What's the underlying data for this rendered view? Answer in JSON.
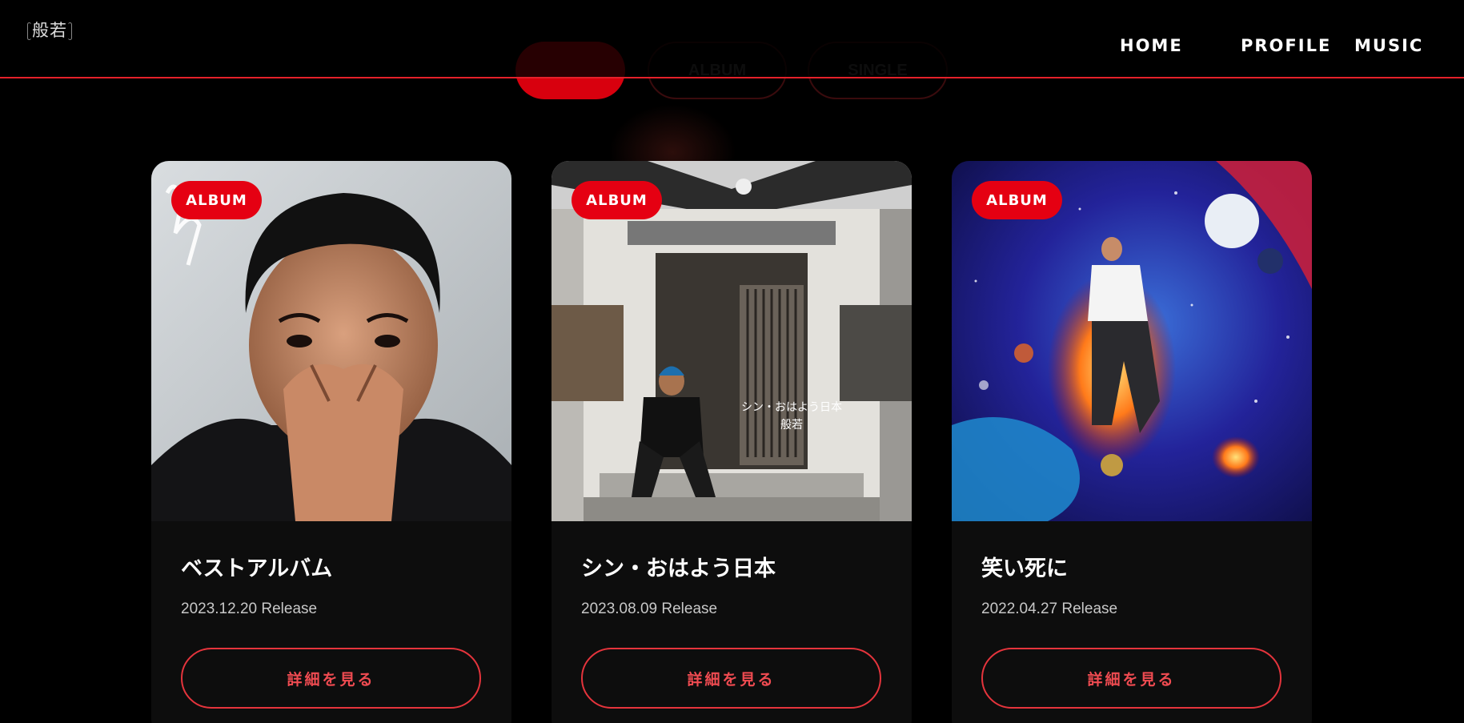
{
  "header": {
    "logo_text": "般若",
    "nav": {
      "home": "HOME",
      "profile": "PROFILE",
      "music": "MUSIC"
    }
  },
  "filters": {
    "album": "ALBUM",
    "single": "SINGLE"
  },
  "colors": {
    "accent": "#e50012",
    "outline": "#e5343c",
    "background": "#000000",
    "card": "#0d0d0d"
  },
  "cards": [
    {
      "badge": "ALBUM",
      "title": "ベストアルバム",
      "date": "2023.12.20 Release",
      "button": "詳細を見る"
    },
    {
      "badge": "ALBUM",
      "title": "シン・おはよう日本",
      "date": "2023.08.09 Release",
      "button": "詳細を見る",
      "cover_text_1": "シン・おはよう日本",
      "cover_text_2": "般若"
    },
    {
      "badge": "ALBUM",
      "title": "笑い死に",
      "date": "2022.04.27 Release",
      "button": "詳細を見る"
    }
  ]
}
